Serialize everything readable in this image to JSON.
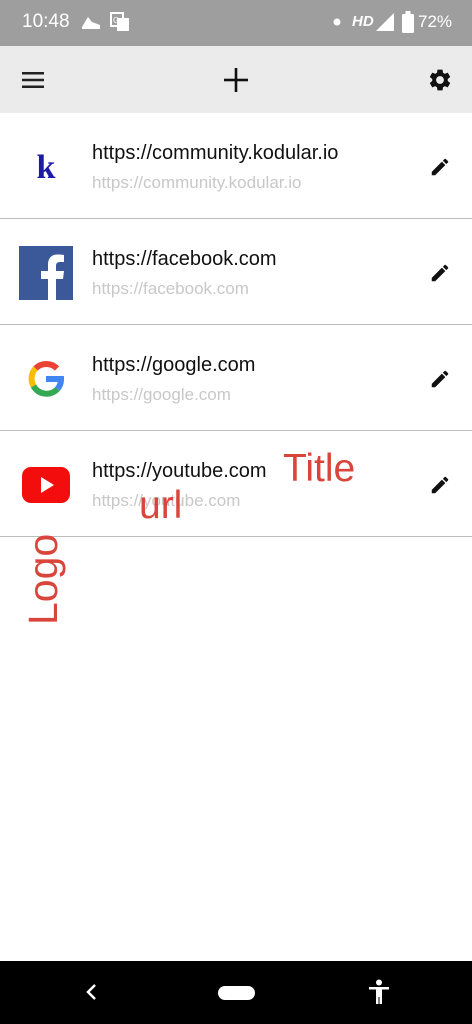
{
  "status_bar": {
    "time": "10:48",
    "network": "HD",
    "battery": "72%",
    "icons": [
      "shoe-icon",
      "translate-icon",
      "dot-icon",
      "signal-icon",
      "battery-icon"
    ]
  },
  "app_bar": {
    "icons": [
      "menu-icon",
      "add-icon",
      "settings-icon"
    ]
  },
  "bookmarks": [
    {
      "title": "https://community.kodular.io",
      "url": "https://community.kodular.io",
      "logo": "kodular-logo"
    },
    {
      "title": "https://facebook.com",
      "url": "https://facebook.com",
      "logo": "facebook-logo"
    },
    {
      "title": "https://google.com",
      "url": "https://google.com",
      "logo": "google-logo"
    },
    {
      "title": "https://youtube.com",
      "url": "https://youtube.com",
      "logo": "youtube-logo"
    }
  ],
  "annotations": {
    "title": "Title",
    "url": "url",
    "logo": "Logo",
    "color": "#d9453b"
  },
  "nav_bar": {
    "icons": [
      "back-icon",
      "home-pill",
      "accessibility-icon"
    ]
  },
  "colors": {
    "status_bar": "#9e9e9e",
    "app_bar": "#ebebeb",
    "url_text": "#c8c8c8",
    "divider": "#bdbdbd"
  }
}
